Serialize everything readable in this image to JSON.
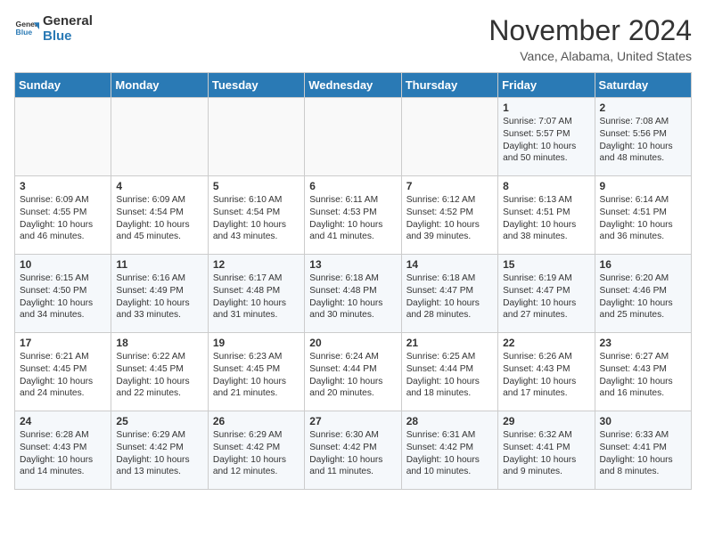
{
  "header": {
    "logo_line1": "General",
    "logo_line2": "Blue",
    "month_year": "November 2024",
    "location": "Vance, Alabama, United States"
  },
  "weekdays": [
    "Sunday",
    "Monday",
    "Tuesday",
    "Wednesday",
    "Thursday",
    "Friday",
    "Saturday"
  ],
  "weeks": [
    [
      {
        "day": "",
        "text": ""
      },
      {
        "day": "",
        "text": ""
      },
      {
        "day": "",
        "text": ""
      },
      {
        "day": "",
        "text": ""
      },
      {
        "day": "",
        "text": ""
      },
      {
        "day": "1",
        "text": "Sunrise: 7:07 AM\nSunset: 5:57 PM\nDaylight: 10 hours and 50 minutes."
      },
      {
        "day": "2",
        "text": "Sunrise: 7:08 AM\nSunset: 5:56 PM\nDaylight: 10 hours and 48 minutes."
      }
    ],
    [
      {
        "day": "3",
        "text": "Sunrise: 6:09 AM\nSunset: 4:55 PM\nDaylight: 10 hours and 46 minutes."
      },
      {
        "day": "4",
        "text": "Sunrise: 6:09 AM\nSunset: 4:54 PM\nDaylight: 10 hours and 45 minutes."
      },
      {
        "day": "5",
        "text": "Sunrise: 6:10 AM\nSunset: 4:54 PM\nDaylight: 10 hours and 43 minutes."
      },
      {
        "day": "6",
        "text": "Sunrise: 6:11 AM\nSunset: 4:53 PM\nDaylight: 10 hours and 41 minutes."
      },
      {
        "day": "7",
        "text": "Sunrise: 6:12 AM\nSunset: 4:52 PM\nDaylight: 10 hours and 39 minutes."
      },
      {
        "day": "8",
        "text": "Sunrise: 6:13 AM\nSunset: 4:51 PM\nDaylight: 10 hours and 38 minutes."
      },
      {
        "day": "9",
        "text": "Sunrise: 6:14 AM\nSunset: 4:51 PM\nDaylight: 10 hours and 36 minutes."
      }
    ],
    [
      {
        "day": "10",
        "text": "Sunrise: 6:15 AM\nSunset: 4:50 PM\nDaylight: 10 hours and 34 minutes."
      },
      {
        "day": "11",
        "text": "Sunrise: 6:16 AM\nSunset: 4:49 PM\nDaylight: 10 hours and 33 minutes."
      },
      {
        "day": "12",
        "text": "Sunrise: 6:17 AM\nSunset: 4:48 PM\nDaylight: 10 hours and 31 minutes."
      },
      {
        "day": "13",
        "text": "Sunrise: 6:18 AM\nSunset: 4:48 PM\nDaylight: 10 hours and 30 minutes."
      },
      {
        "day": "14",
        "text": "Sunrise: 6:18 AM\nSunset: 4:47 PM\nDaylight: 10 hours and 28 minutes."
      },
      {
        "day": "15",
        "text": "Sunrise: 6:19 AM\nSunset: 4:47 PM\nDaylight: 10 hours and 27 minutes."
      },
      {
        "day": "16",
        "text": "Sunrise: 6:20 AM\nSunset: 4:46 PM\nDaylight: 10 hours and 25 minutes."
      }
    ],
    [
      {
        "day": "17",
        "text": "Sunrise: 6:21 AM\nSunset: 4:45 PM\nDaylight: 10 hours and 24 minutes."
      },
      {
        "day": "18",
        "text": "Sunrise: 6:22 AM\nSunset: 4:45 PM\nDaylight: 10 hours and 22 minutes."
      },
      {
        "day": "19",
        "text": "Sunrise: 6:23 AM\nSunset: 4:45 PM\nDaylight: 10 hours and 21 minutes."
      },
      {
        "day": "20",
        "text": "Sunrise: 6:24 AM\nSunset: 4:44 PM\nDaylight: 10 hours and 20 minutes."
      },
      {
        "day": "21",
        "text": "Sunrise: 6:25 AM\nSunset: 4:44 PM\nDaylight: 10 hours and 18 minutes."
      },
      {
        "day": "22",
        "text": "Sunrise: 6:26 AM\nSunset: 4:43 PM\nDaylight: 10 hours and 17 minutes."
      },
      {
        "day": "23",
        "text": "Sunrise: 6:27 AM\nSunset: 4:43 PM\nDaylight: 10 hours and 16 minutes."
      }
    ],
    [
      {
        "day": "24",
        "text": "Sunrise: 6:28 AM\nSunset: 4:43 PM\nDaylight: 10 hours and 14 minutes."
      },
      {
        "day": "25",
        "text": "Sunrise: 6:29 AM\nSunset: 4:42 PM\nDaylight: 10 hours and 13 minutes."
      },
      {
        "day": "26",
        "text": "Sunrise: 6:29 AM\nSunset: 4:42 PM\nDaylight: 10 hours and 12 minutes."
      },
      {
        "day": "27",
        "text": "Sunrise: 6:30 AM\nSunset: 4:42 PM\nDaylight: 10 hours and 11 minutes."
      },
      {
        "day": "28",
        "text": "Sunrise: 6:31 AM\nSunset: 4:42 PM\nDaylight: 10 hours and 10 minutes."
      },
      {
        "day": "29",
        "text": "Sunrise: 6:32 AM\nSunset: 4:41 PM\nDaylight: 10 hours and 9 minutes."
      },
      {
        "day": "30",
        "text": "Sunrise: 6:33 AM\nSunset: 4:41 PM\nDaylight: 10 hours and 8 minutes."
      }
    ]
  ]
}
